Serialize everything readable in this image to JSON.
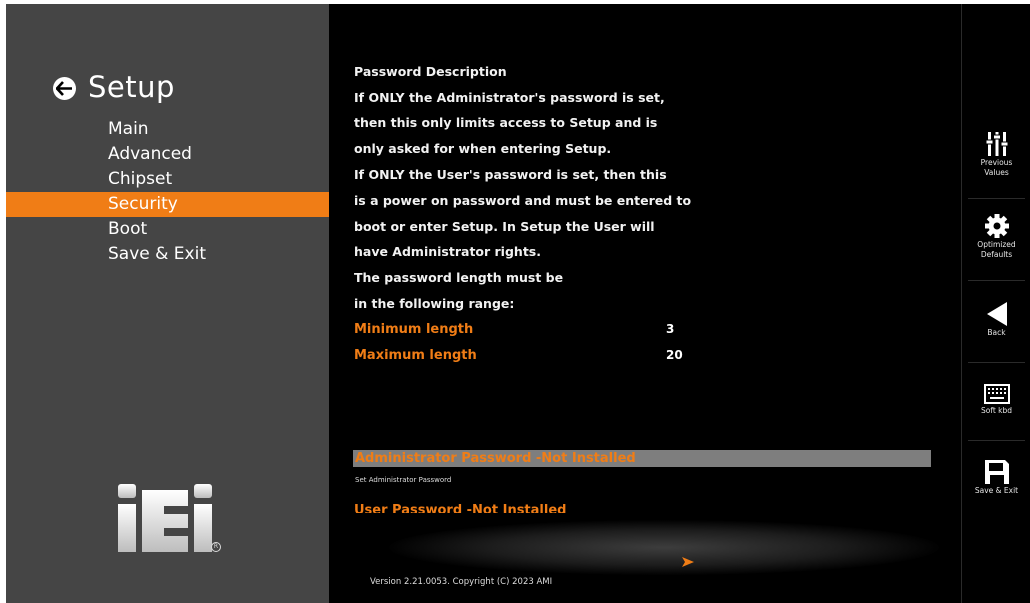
{
  "sidebar": {
    "title": "Setup",
    "items": [
      {
        "label": "Main"
      },
      {
        "label": "Advanced"
      },
      {
        "label": "Chipset"
      },
      {
        "label": "Security"
      },
      {
        "label": "Boot"
      },
      {
        "label": "Save & Exit"
      }
    ],
    "active_item": "Security",
    "logo_text": "iEi",
    "active_color": "#f07d16"
  },
  "content": {
    "description": [
      "Password Description",
      "If ONLY the Administrator's password is set,",
      "then this only limits access to Setup and is",
      "only asked for when entering Setup.",
      "If ONLY the User's password is set, then this",
      "is a power on password and must be entered to",
      "boot or enter Setup. In Setup the User will",
      "have Administrator rights.",
      "The password length must be",
      "in the following range:"
    ],
    "min_length": {
      "label": "Minimum length",
      "value": "3"
    },
    "max_length": {
      "label": "Maximum length",
      "value": "20"
    },
    "admin_password": {
      "label": "Administrator Password -Not Installed",
      "help": "Set Administrator Password"
    },
    "user_password": {
      "label": "User Password -Not Installed"
    },
    "version": "Version 2.21.0053. Copyright (C) 2023 AMI"
  },
  "toolbar": {
    "previous_values": {
      "line1": "Previous",
      "line2": "Values",
      "icon": "sliders-icon"
    },
    "optimized_defaults": {
      "line1": "Optimized",
      "line2": "Defaults",
      "icon": "gear-icon"
    },
    "back": {
      "label": "Back",
      "icon": "back-triangle-icon"
    },
    "soft_kbd": {
      "label": "Soft kbd",
      "icon": "keyboard-icon"
    },
    "save_exit": {
      "label": "Save & Exit",
      "icon": "floppy-disk-icon"
    }
  }
}
